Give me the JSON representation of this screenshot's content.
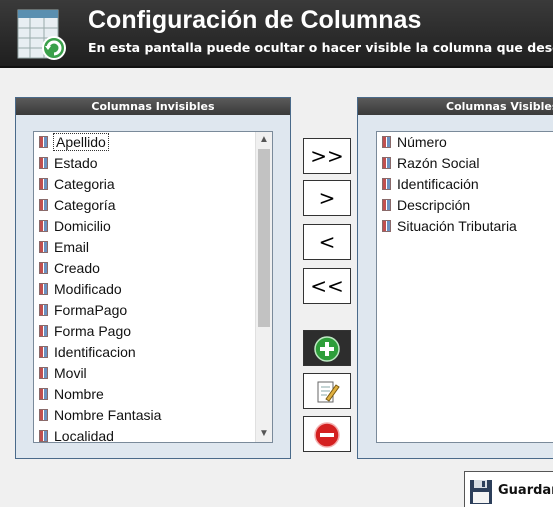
{
  "header": {
    "title": "Configuración de Columnas",
    "subtitle": "En esta pantalla puede ocultar o hacer visible la columna que desee",
    "icon": "spreadsheet-refresh-icon"
  },
  "left_panel": {
    "title": "Columnas Invisibles",
    "selected_index": 0,
    "items": [
      "Apellido",
      "Estado",
      "Categoria",
      "Categoría",
      "Domicilio",
      "Email",
      "Creado",
      "Modificado",
      "FormaPago",
      "Forma Pago",
      "Identificacion",
      "Movil",
      "Nombre",
      "Nombre Fantasia",
      "Localidad"
    ]
  },
  "right_panel": {
    "title": "Columnas Visibles",
    "items": [
      "Número",
      "Razón Social",
      "Identificación",
      "Descripción",
      "Situación Tributaria"
    ]
  },
  "buttons": {
    "move_all_right": ">>",
    "move_right": ">",
    "move_left": "<",
    "move_all_left": "<<",
    "add_icon": "plus-icon",
    "edit_icon": "edit-document-icon",
    "delete_icon": "minus-icon"
  },
  "save": {
    "label": "Guardar",
    "icon": "floppy-disk-icon"
  },
  "colors": {
    "header_bg": "#262626",
    "panel_bg": "#dfe7ef",
    "panel_title_bg": "#444444",
    "add_green": "#2e9e3a",
    "delete_red": "#d42020"
  }
}
